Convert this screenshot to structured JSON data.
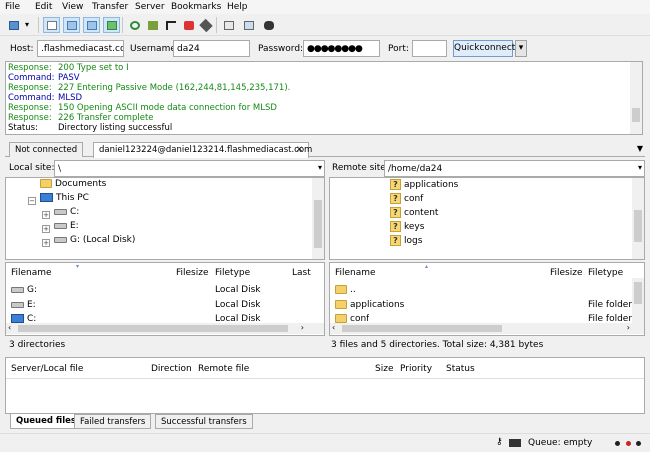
{
  "menu": [
    "File",
    "Edit",
    "View",
    "Transfer",
    "Server",
    "Bookmarks",
    "Help"
  ],
  "toolbar": {
    "icons": [
      "site-manager-icon",
      "dropdown-arrow-icon",
      "toggle-log-icon",
      "toggle-local-tree-icon",
      "toggle-remote-tree-icon",
      "toggle-queue-icon",
      "refresh-icon",
      "process-queue-icon",
      "cancel-icon",
      "disconnect-icon",
      "reconnect-icon",
      "filter-icon",
      "compare-icon",
      "search-icon"
    ]
  },
  "quickconnect": {
    "host_label": "Host:",
    "host_value": ".flashmediacast.com",
    "username_label": "Username:",
    "username_value": "da24",
    "password_label": "Password:",
    "password_value": "●●●●●●●●",
    "port_label": "Port:",
    "port_value": "",
    "button_label": "Quickconnect",
    "dropdown_arrow": "▾"
  },
  "log": [
    {
      "key": "Response:",
      "value": "200 Type set to I",
      "color": "green"
    },
    {
      "key": "Command:",
      "value": "PASV",
      "color": "blue"
    },
    {
      "key": "Response:",
      "value": "227 Entering Passive Mode (162,244,81,145,235,171).",
      "color": "green"
    },
    {
      "key": "Command:",
      "value": "MLSD",
      "color": "blue"
    },
    {
      "key": "Response:",
      "value": "150 Opening ASCII mode data connection for MLSD",
      "color": "green"
    },
    {
      "key": "Response:",
      "value": "226 Transfer complete",
      "color": "green"
    },
    {
      "key": "Status:",
      "value": "Directory listing successful",
      "color": "black"
    }
  ],
  "tabs": [
    "Not connected",
    "daniel123224@daniel123214.flashmediacast.com"
  ],
  "tab_close": "✕",
  "tab_menu": "▼",
  "local": {
    "site_label": "Local site:",
    "site_value": "\\",
    "tree": [
      {
        "label": "Documents",
        "icon": "folder-icon",
        "expander": ""
      },
      {
        "label": "This PC",
        "icon": "computer-icon",
        "expander": "−"
      },
      {
        "label": "C:",
        "icon": "drive-icon",
        "expander": "+"
      },
      {
        "label": "E:",
        "icon": "drive-icon",
        "expander": "+"
      },
      {
        "label": "G: (Local Disk)",
        "icon": "drive-icon",
        "expander": "+"
      }
    ],
    "columns": [
      "Filename",
      "Filesize",
      "Filetype",
      "Last"
    ],
    "files": [
      {
        "name": "G:",
        "size": "",
        "type": "Local Disk"
      },
      {
        "name": "E:",
        "size": "",
        "type": "Local Disk"
      },
      {
        "name": "C:",
        "size": "",
        "type": "Local Disk"
      }
    ],
    "status": "3 directories"
  },
  "remote": {
    "site_label": "Remote site:",
    "site_value": "/home/da24",
    "tree": [
      "applications",
      "conf",
      "content",
      "keys",
      "logs"
    ],
    "columns": [
      "Filename",
      "Filesize",
      "Filetype"
    ],
    "files": [
      {
        "name": "..",
        "size": "",
        "type": ""
      },
      {
        "name": "applications",
        "size": "",
        "type": "File folder"
      },
      {
        "name": "conf",
        "size": "",
        "type": "File folder"
      }
    ],
    "status": "3 files and 5 directories. Total size: 4,381 bytes"
  },
  "queue": {
    "columns": [
      "Server/Local file",
      "Direction",
      "Remote file",
      "Size",
      "Priority",
      "Status"
    ],
    "tabs": [
      "Queued files",
      "Failed transfers",
      "Successful transfers"
    ],
    "status": "Queue: empty"
  },
  "colors": {
    "response": "#138a13",
    "command": "#0000aa",
    "accent": "#cfe6fb"
  }
}
